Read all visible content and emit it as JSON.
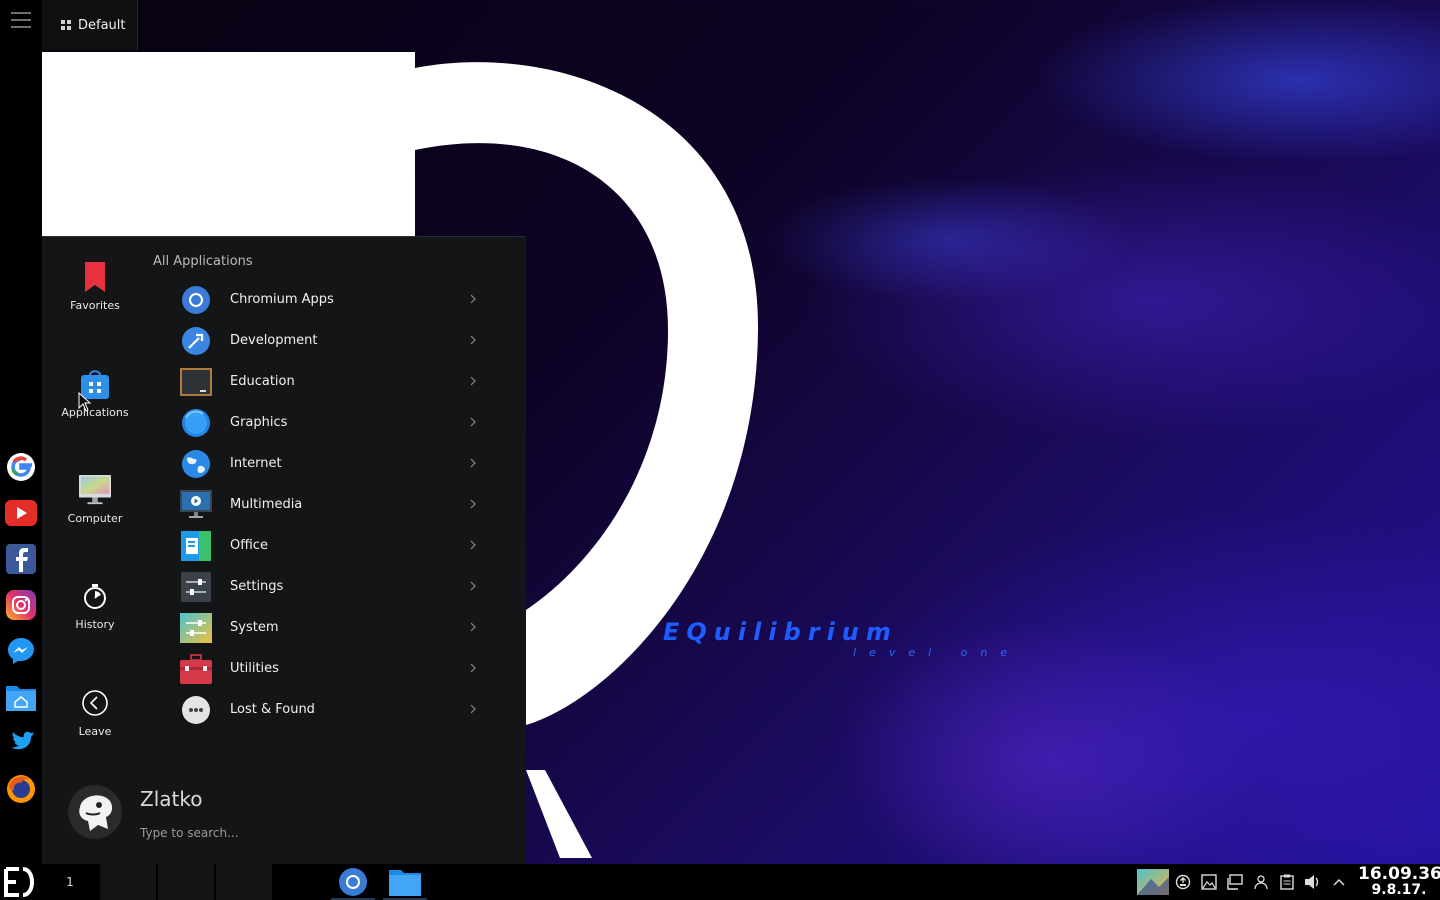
{
  "activity": {
    "label": "Default"
  },
  "wallpaper": {
    "title": "EQuilibrium",
    "subtitle": "level one"
  },
  "dock": {
    "apps": [
      {
        "icon": "google-icon",
        "name": "google"
      },
      {
        "icon": "youtube-icon",
        "name": "youtube"
      },
      {
        "icon": "facebook-icon",
        "name": "facebook"
      },
      {
        "icon": "instagram-icon",
        "name": "instagram"
      },
      {
        "icon": "messenger-icon",
        "name": "messenger"
      },
      {
        "icon": "home-folder-icon",
        "name": "home-folder"
      },
      {
        "icon": "twitter-icon",
        "name": "twitter"
      },
      {
        "icon": "firefox-icon",
        "name": "firefox"
      }
    ]
  },
  "launcher": {
    "nav": [
      {
        "label": "Favorites",
        "icon": "bookmark-icon"
      },
      {
        "label": "Applications",
        "icon": "applications-icon"
      },
      {
        "label": "Computer",
        "icon": "computer-icon"
      },
      {
        "label": "History",
        "icon": "history-icon"
      },
      {
        "label": "Leave",
        "icon": "leave-icon"
      }
    ],
    "section_title": "All Applications",
    "categories": [
      {
        "label": "Chromium Apps",
        "icon": "chromium-icon"
      },
      {
        "label": "Development",
        "icon": "development-icon"
      },
      {
        "label": "Education",
        "icon": "education-icon"
      },
      {
        "label": "Graphics",
        "icon": "graphics-icon"
      },
      {
        "label": "Internet",
        "icon": "internet-icon"
      },
      {
        "label": "Multimedia",
        "icon": "multimedia-icon"
      },
      {
        "label": "Office",
        "icon": "office-icon"
      },
      {
        "label": "Settings",
        "icon": "settings-icon"
      },
      {
        "label": "System",
        "icon": "system-icon"
      },
      {
        "label": "Utilities",
        "icon": "utilities-icon"
      },
      {
        "label": "Lost & Found",
        "icon": "lost-found-icon"
      }
    ],
    "user": {
      "name": "Zlatko"
    },
    "search": {
      "placeholder": "Type to search..."
    }
  },
  "taskbar": {
    "pager": [
      "1",
      "",
      "",
      ""
    ],
    "tasks": [
      {
        "icon": "chromium-icon",
        "name": "chromium-task"
      },
      {
        "icon": "file-manager-icon",
        "name": "file-manager-task"
      }
    ],
    "tray": [
      "activity-thumbnail-icon",
      "updates-icon",
      "screenshot-icon",
      "network-icon",
      "kdeconnect-icon",
      "clipboard-icon",
      "volume-icon",
      "expand-tray-icon"
    ]
  },
  "clock": {
    "time": "16.09.36",
    "date": "9.8.17."
  },
  "colors": {
    "accent": "#1d5cff",
    "launcher_bg": "#141517",
    "panel_bg": "#000000"
  }
}
